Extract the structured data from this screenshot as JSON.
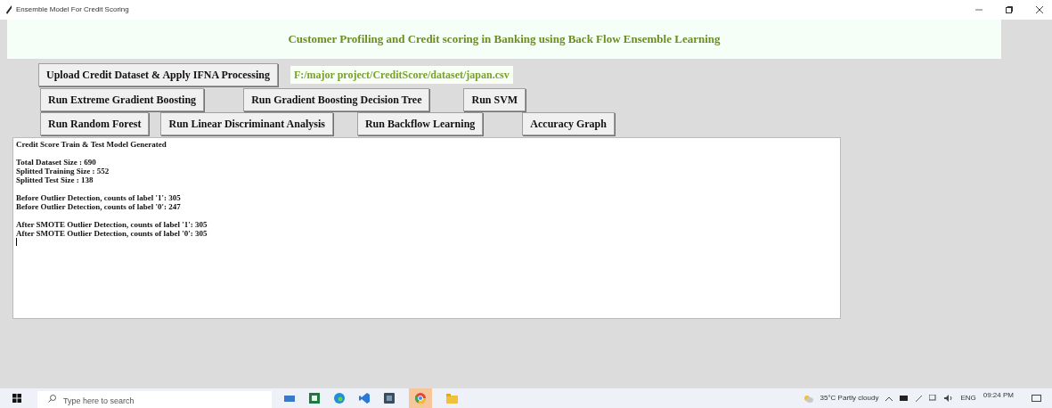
{
  "window": {
    "title": "Ensemble Model For Credit Scoring"
  },
  "heading": "Customer Profiling and Credit scoring in Banking using Back Flow Ensemble Learning",
  "button_rows": [
    [
      {
        "label": "Upload Credit Dataset & Apply IFNA Processing"
      }
    ],
    [
      {
        "label": "Run Extreme Gradient Boosting"
      },
      {
        "label": "Run Gradient Boosting Decision Tree"
      },
      {
        "label": "Run SVM"
      }
    ],
    [
      {
        "label": "Run Random Forest"
      },
      {
        "label": "Run Linear Discriminant Analysis"
      },
      {
        "label": "Run Backflow Learning"
      },
      {
        "label": "Accuracy Graph"
      }
    ]
  ],
  "path_label": "F:/major project/CreditScore/dataset/japan.csv",
  "output": [
    [
      "Credit Score Train & Test Model Generated"
    ],
    [
      "Total Dataset Size : 690",
      "Splitted Training Size : 552",
      "Splitted Test Size : 138"
    ],
    [
      "Before Outlier Detection, counts of label '1': 305",
      "Before Outlier Detection, counts of label '0': 247"
    ],
    [
      "After SMOTE Outlier Detection, counts of label '1': 305",
      "After SMOTE Outlier Detection, counts of label '0': 305"
    ]
  ],
  "taskbar": {
    "search": {
      "placeholder": "Type here to search"
    },
    "weather": "35°C Partly cloudy",
    "language": "ENG",
    "time": "09:24 PM"
  }
}
